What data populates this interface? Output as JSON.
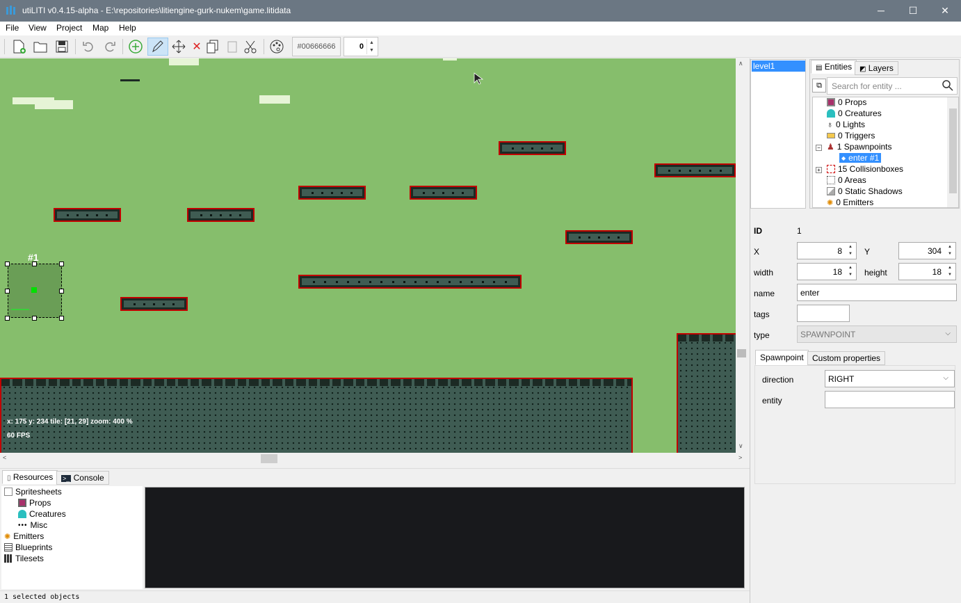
{
  "window": {
    "title": "utiLITI v0.4.15-alpha - E:\\repositories\\litiengine-gurk-nukem\\game.litidata",
    "minimize": "─",
    "maximize": "☐",
    "close": "✕"
  },
  "menu": [
    "File",
    "View",
    "Project",
    "Map",
    "Help"
  ],
  "toolbar": {
    "color_value": "#00666666",
    "spinner_value": "0"
  },
  "map": {
    "spawn_label": "#1",
    "coords": "x: 175 y: 234 tile: [21, 29] zoom: 400 %",
    "fps": "60 FPS"
  },
  "bottom": {
    "tabs": [
      "Resources",
      "Console"
    ],
    "resources": [
      {
        "label": "Spritesheets",
        "icon": "spritesheet-icon"
      },
      {
        "label": "Props",
        "icon": "prop-icon"
      },
      {
        "label": "Creatures",
        "icon": "creature-icon"
      },
      {
        "label": "Misc",
        "icon": "misc-icon"
      },
      {
        "label": "Emitters",
        "icon": "emitter-icon"
      },
      {
        "label": "Blueprints",
        "icon": "blueprint-icon"
      },
      {
        "label": "Tilesets",
        "icon": "tileset-icon"
      }
    ]
  },
  "status": "1 selected objects",
  "maps": [
    "level1"
  ],
  "entities": {
    "tabs": [
      "Entities",
      "Layers"
    ],
    "search_placeholder": "Search for entity ...",
    "tree": [
      {
        "label": "0 Props",
        "icon": "prop-icon"
      },
      {
        "label": "0 Creatures",
        "icon": "creature-icon"
      },
      {
        "label": "0 Lights",
        "icon": "light-icon"
      },
      {
        "label": "0 Triggers",
        "icon": "trigger-icon"
      },
      {
        "label": "1 Spawnpoints",
        "icon": "spawnpoint-icon"
      },
      {
        "label": "enter #1",
        "icon": "dot-icon"
      },
      {
        "label": "15 Collisionboxes",
        "icon": "collisionbox-icon"
      },
      {
        "label": "0 Areas",
        "icon": "area-icon"
      },
      {
        "label": "0 Static Shadows",
        "icon": "shadow-icon"
      },
      {
        "label": "0 Emitters",
        "icon": "emitter-icon"
      }
    ]
  },
  "props": {
    "id_label": "ID",
    "id_value": "1",
    "x_label": "X",
    "x_value": "8",
    "y_label": "Y",
    "y_value": "304",
    "width_label": "width",
    "width_value": "18",
    "height_label": "height",
    "height_value": "18",
    "name_label": "name",
    "name_value": "enter",
    "tags_label": "tags",
    "tags_value": "",
    "type_label": "type",
    "type_value": "SPAWNPOINT",
    "tabs": [
      "Spawnpoint",
      "Custom properties"
    ],
    "direction_label": "direction",
    "direction_value": "RIGHT",
    "entity_label": "entity",
    "entity_value": ""
  }
}
